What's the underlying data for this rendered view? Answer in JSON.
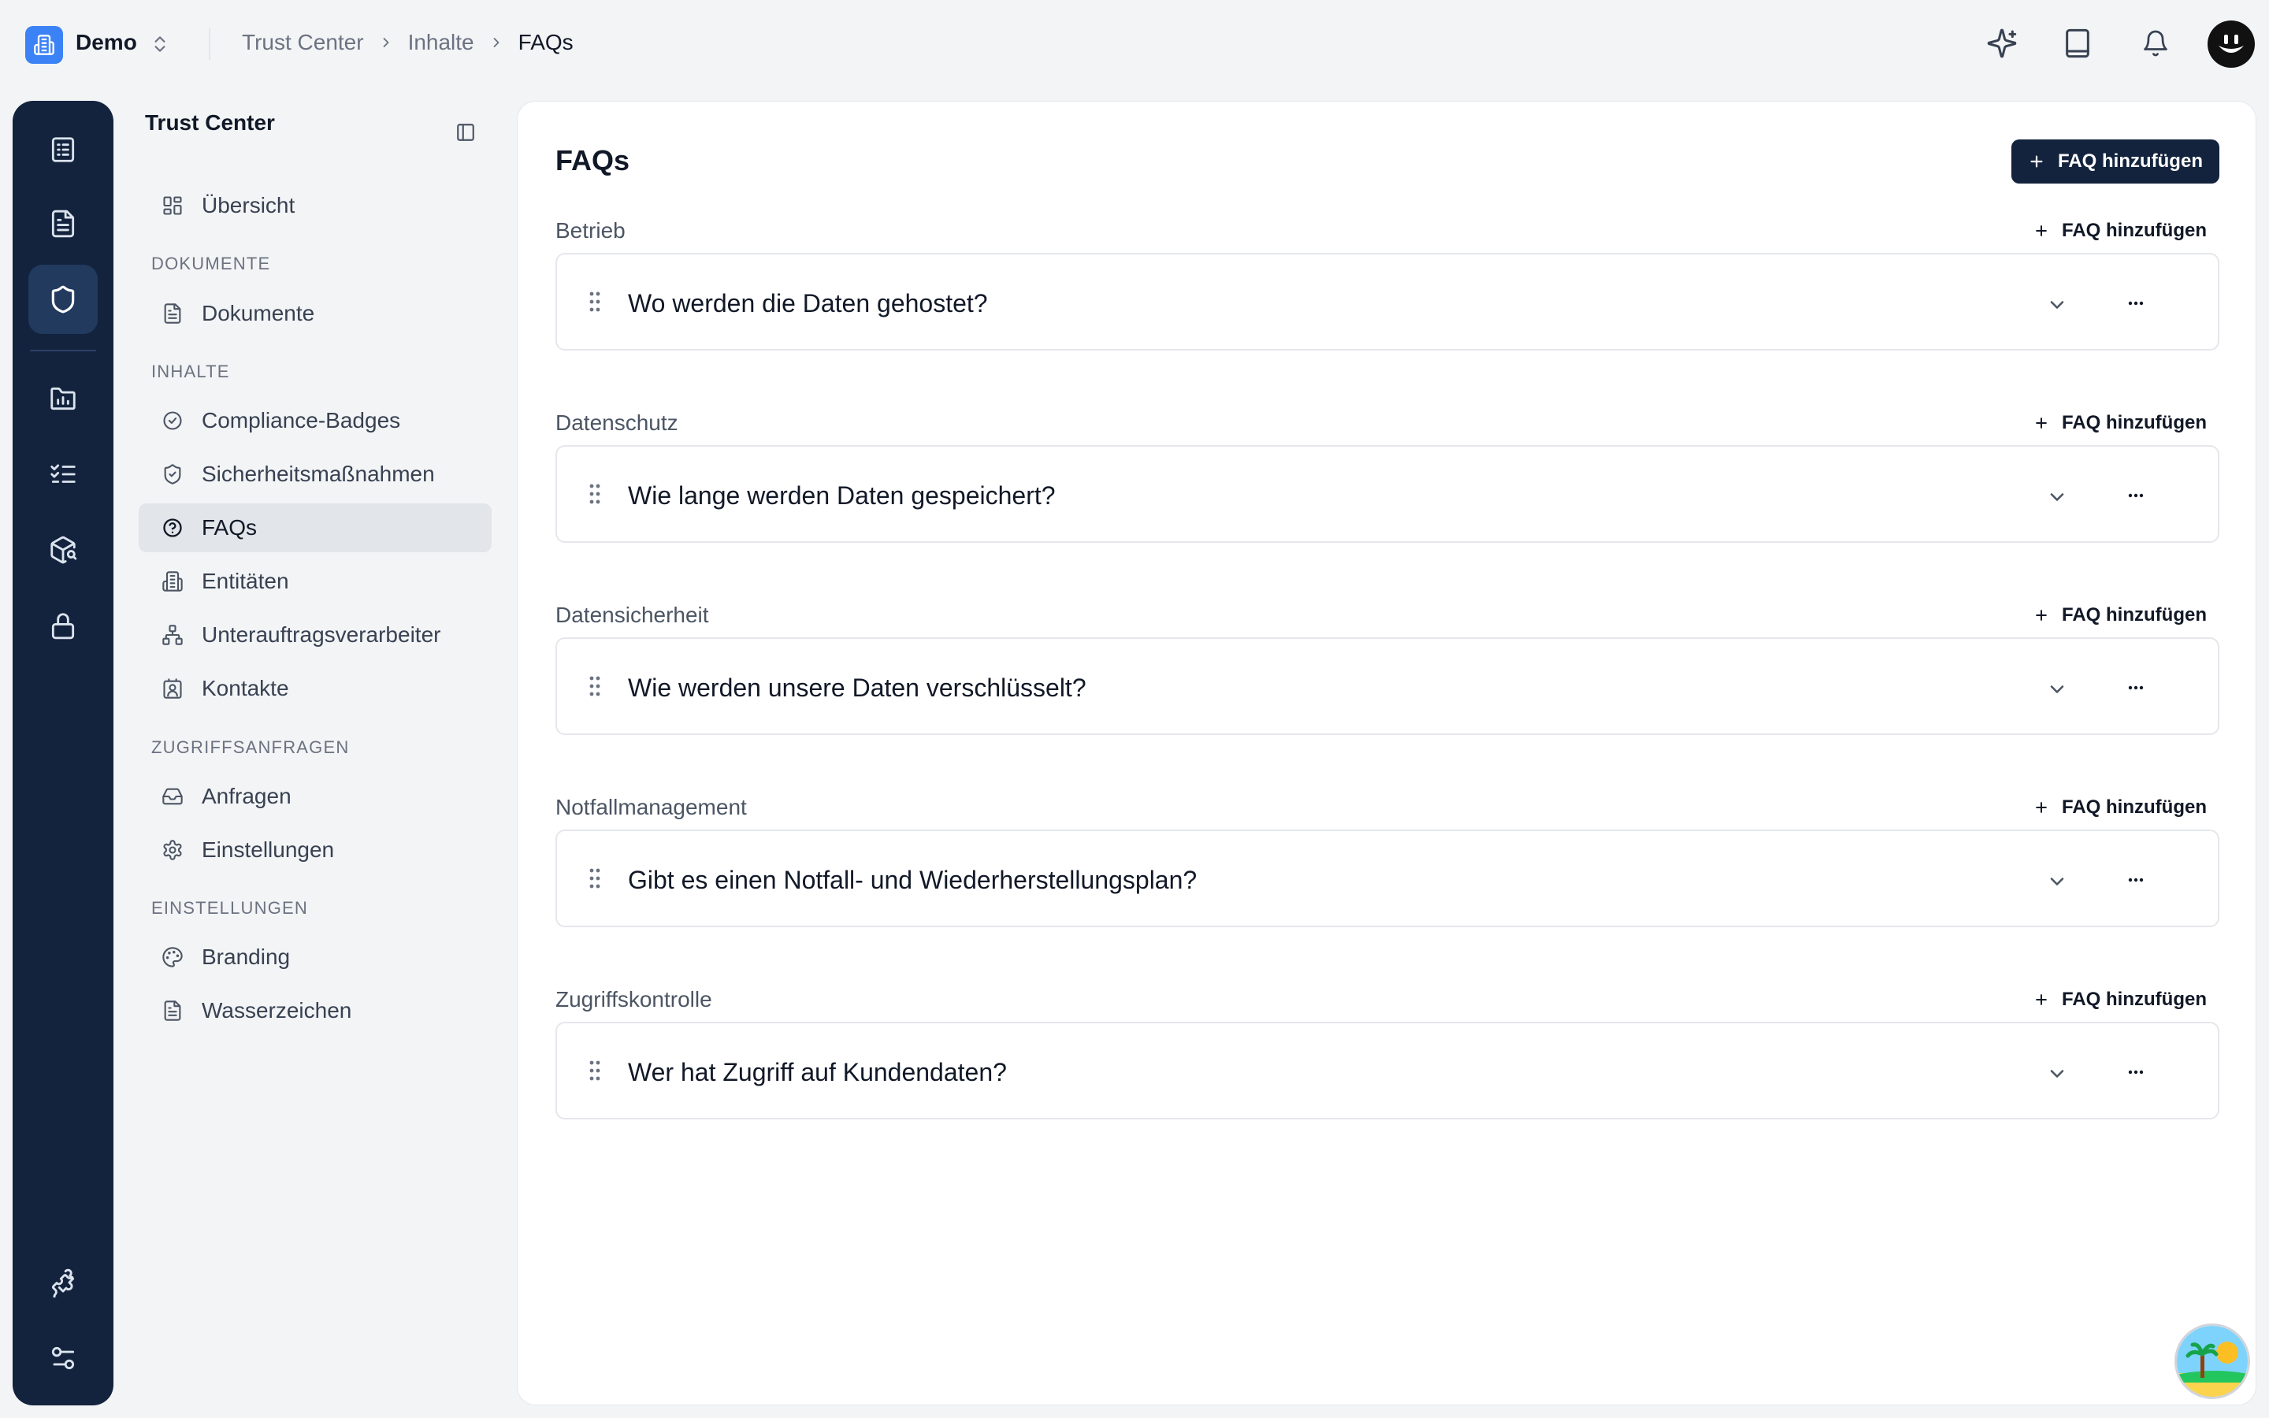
{
  "workspace": {
    "name": "Demo"
  },
  "breadcrumb": {
    "items": [
      "Trust Center",
      "Inhalte",
      "FAQs"
    ]
  },
  "topbar_icons": [
    "sparkles-icon",
    "tablet-icon",
    "bell-icon",
    "user-avatar"
  ],
  "rail": {
    "items": [
      "checklist-icon",
      "document-icon",
      "shield-icon",
      "chart-icon",
      "tasks-icon",
      "package-search-icon",
      "lock-icon"
    ],
    "bottom": [
      "puzzle-icon",
      "sliders-icon"
    ],
    "active": "shield-icon"
  },
  "sidebar": {
    "title": "Trust Center",
    "overview": "Übersicht",
    "sections": {
      "dokumente": "DOKUMENTE",
      "inhalte": "INHALTE",
      "zugriffsanfragen": "ZUGRIFFSANFRAGEN",
      "einstellungen": "EINSTELLUNGEN"
    },
    "items": {
      "dokumente": "Dokumente",
      "badges": "Compliance-Badges",
      "sicherheit": "Sicherheitsmaßnahmen",
      "faqs": "FAQs",
      "entitaeten": "Entitäten",
      "unterauftrag": "Unterauftragsverarbeiter",
      "kontakte": "Kontakte",
      "anfragen": "Anfragen",
      "einstellungen": "Einstellungen",
      "branding": "Branding",
      "wasserzeichen": "Wasserzeichen"
    },
    "active_item": "FAQs"
  },
  "main": {
    "title": "FAQs",
    "add_button": "FAQ hinzufügen",
    "groups": [
      {
        "title": "Betrieb",
        "add_label": "FAQ hinzufügen",
        "question": "Wo werden die Daten gehostet?"
      },
      {
        "title": "Datenschutz",
        "add_label": "FAQ hinzufügen",
        "question": "Wie lange werden Daten gespeichert?"
      },
      {
        "title": "Datensicherheit",
        "add_label": "FAQ hinzufügen",
        "question": "Wie werden unsere Daten verschlüsselt?"
      },
      {
        "title": "Notfallmanagement",
        "add_label": "FAQ hinzufügen",
        "question": "Gibt es einen Notfall- und Wiederherstellungsplan?"
      },
      {
        "title": "Zugriffskontrolle",
        "add_label": "FAQ hinzufügen",
        "question": "Wer hat Zugriff auf Kundendaten?"
      }
    ]
  },
  "colors": {
    "navy": "#13233d",
    "accent_blue": "#3b82f6",
    "active_bg": "#e2e5e9"
  }
}
